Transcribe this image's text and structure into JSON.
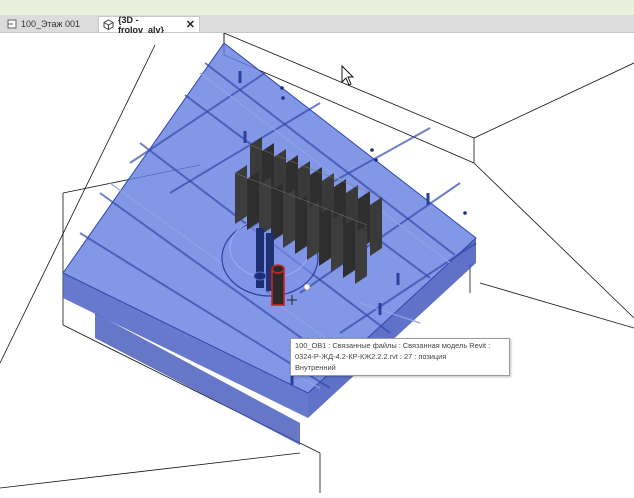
{
  "tabs": [
    {
      "label": "100_Этаж 001",
      "icon": "floor-plan-icon",
      "active": false
    },
    {
      "label": "{3D - frolov_alv}",
      "icon": "3d-view-icon",
      "active": true,
      "close_icon": "close-icon"
    }
  ],
  "tooltip": {
    "line1": "100_ОВ1 : Связанные файлы : Связанная модель Revit :",
    "line2": "0324-Р-ЖД-4.2-КР-КЖ2.2.2.rvt : 27 : позиция",
    "line3": "Внутренний"
  },
  "colors": {
    "slab_top": "#5f79d9",
    "slab_side": "#4b62c4",
    "edge": "#2e46b0",
    "fins": "#2c2c2c",
    "pipe_red": "#cc2222",
    "pipe_dark": "#1e2c70",
    "tab_bar": "#dcdcdc",
    "top_strip": "#e8f0dc"
  }
}
